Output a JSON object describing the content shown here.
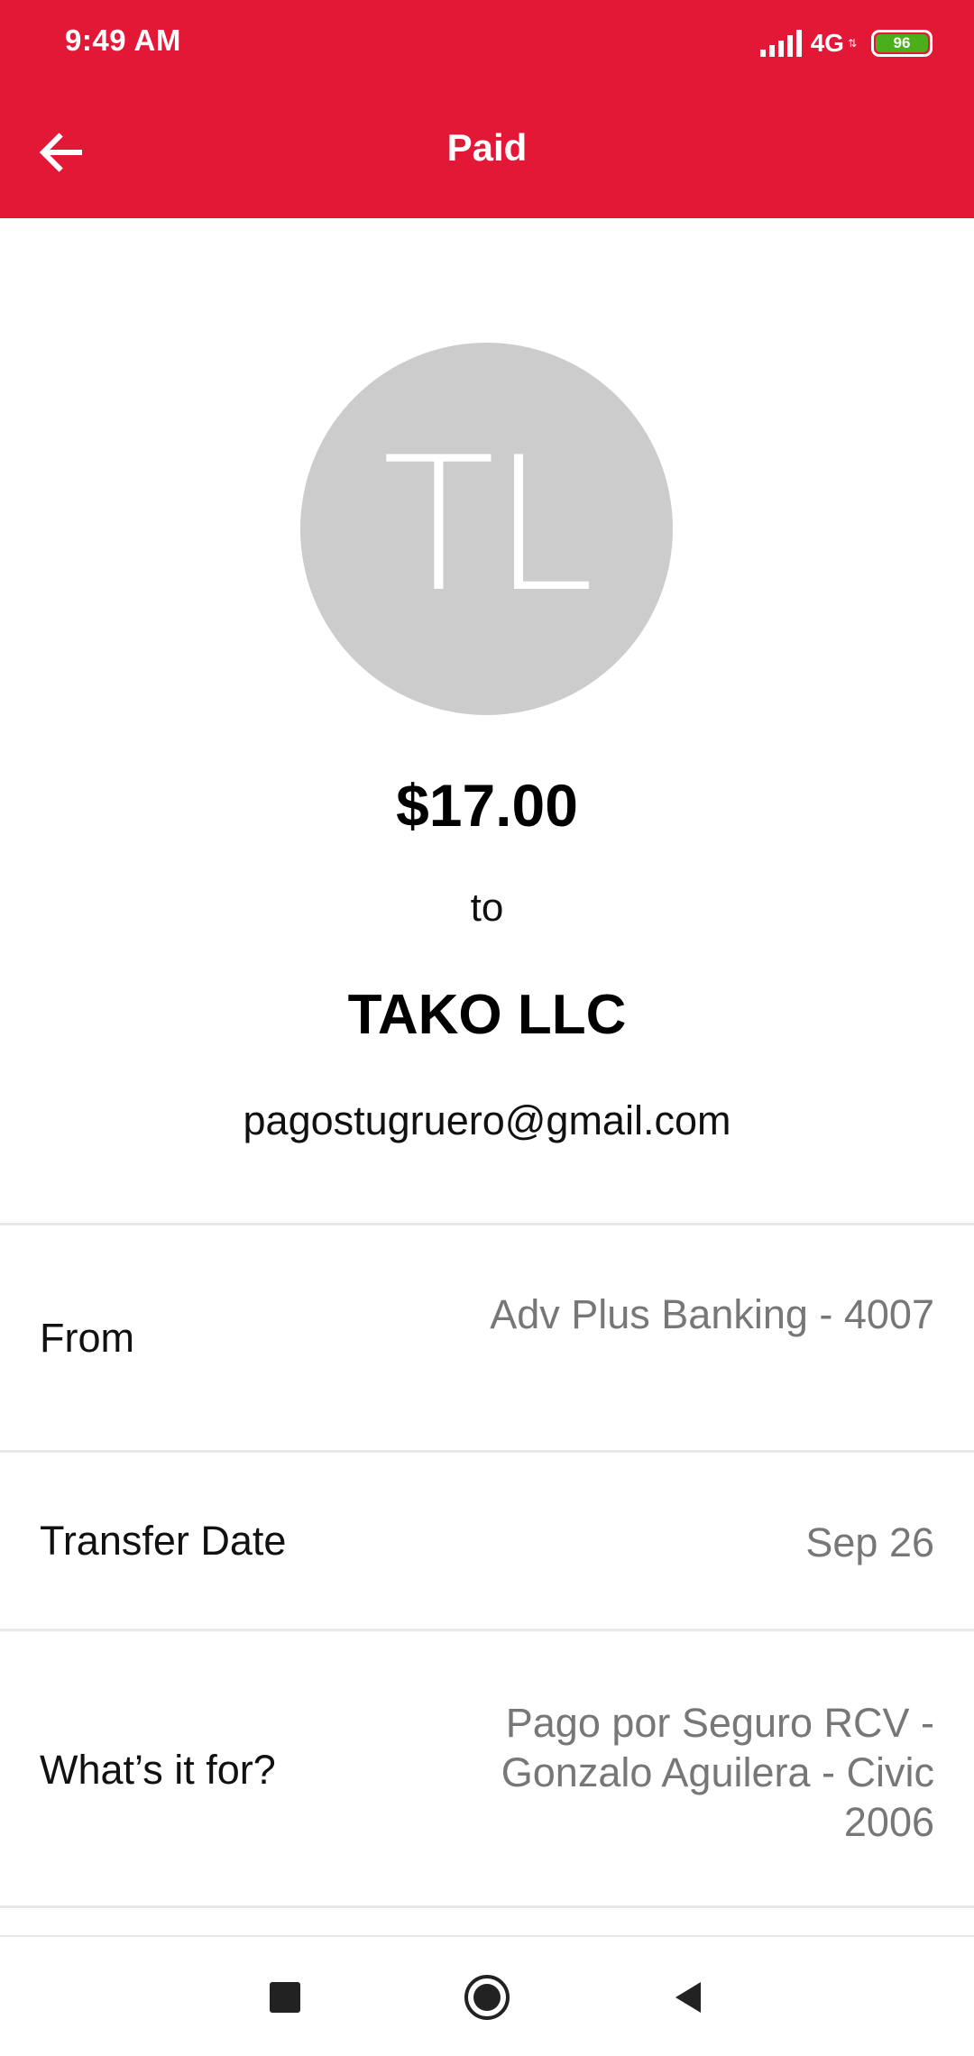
{
  "status_bar": {
    "time": "9:49 AM",
    "network": "4G",
    "battery": "96",
    "battery_color": "#4caf1a",
    "signal_icon": "signal-icon"
  },
  "app_bar": {
    "title": "Paid",
    "back_icon": "arrow-left-icon",
    "background": "#e31837"
  },
  "payment": {
    "avatar_initials": "TL",
    "amount": "$17.00",
    "to_label": "to",
    "payee_name": "TAKO LLC",
    "payee_email": "pagostugruero@gmail.com"
  },
  "details": [
    {
      "label": "From",
      "value": "Adv Plus Banking - 4007"
    },
    {
      "label": "Transfer Date",
      "value": "Sep 26"
    },
    {
      "label": "What’s it for?",
      "value": "Pago por Seguro RCV - Gonzalo Aguilera - Civic 2006"
    }
  ],
  "nav_bar": {
    "recents_icon": "square-icon",
    "home_icon": "circle-icon",
    "back_icon": "triangle-back-icon"
  }
}
